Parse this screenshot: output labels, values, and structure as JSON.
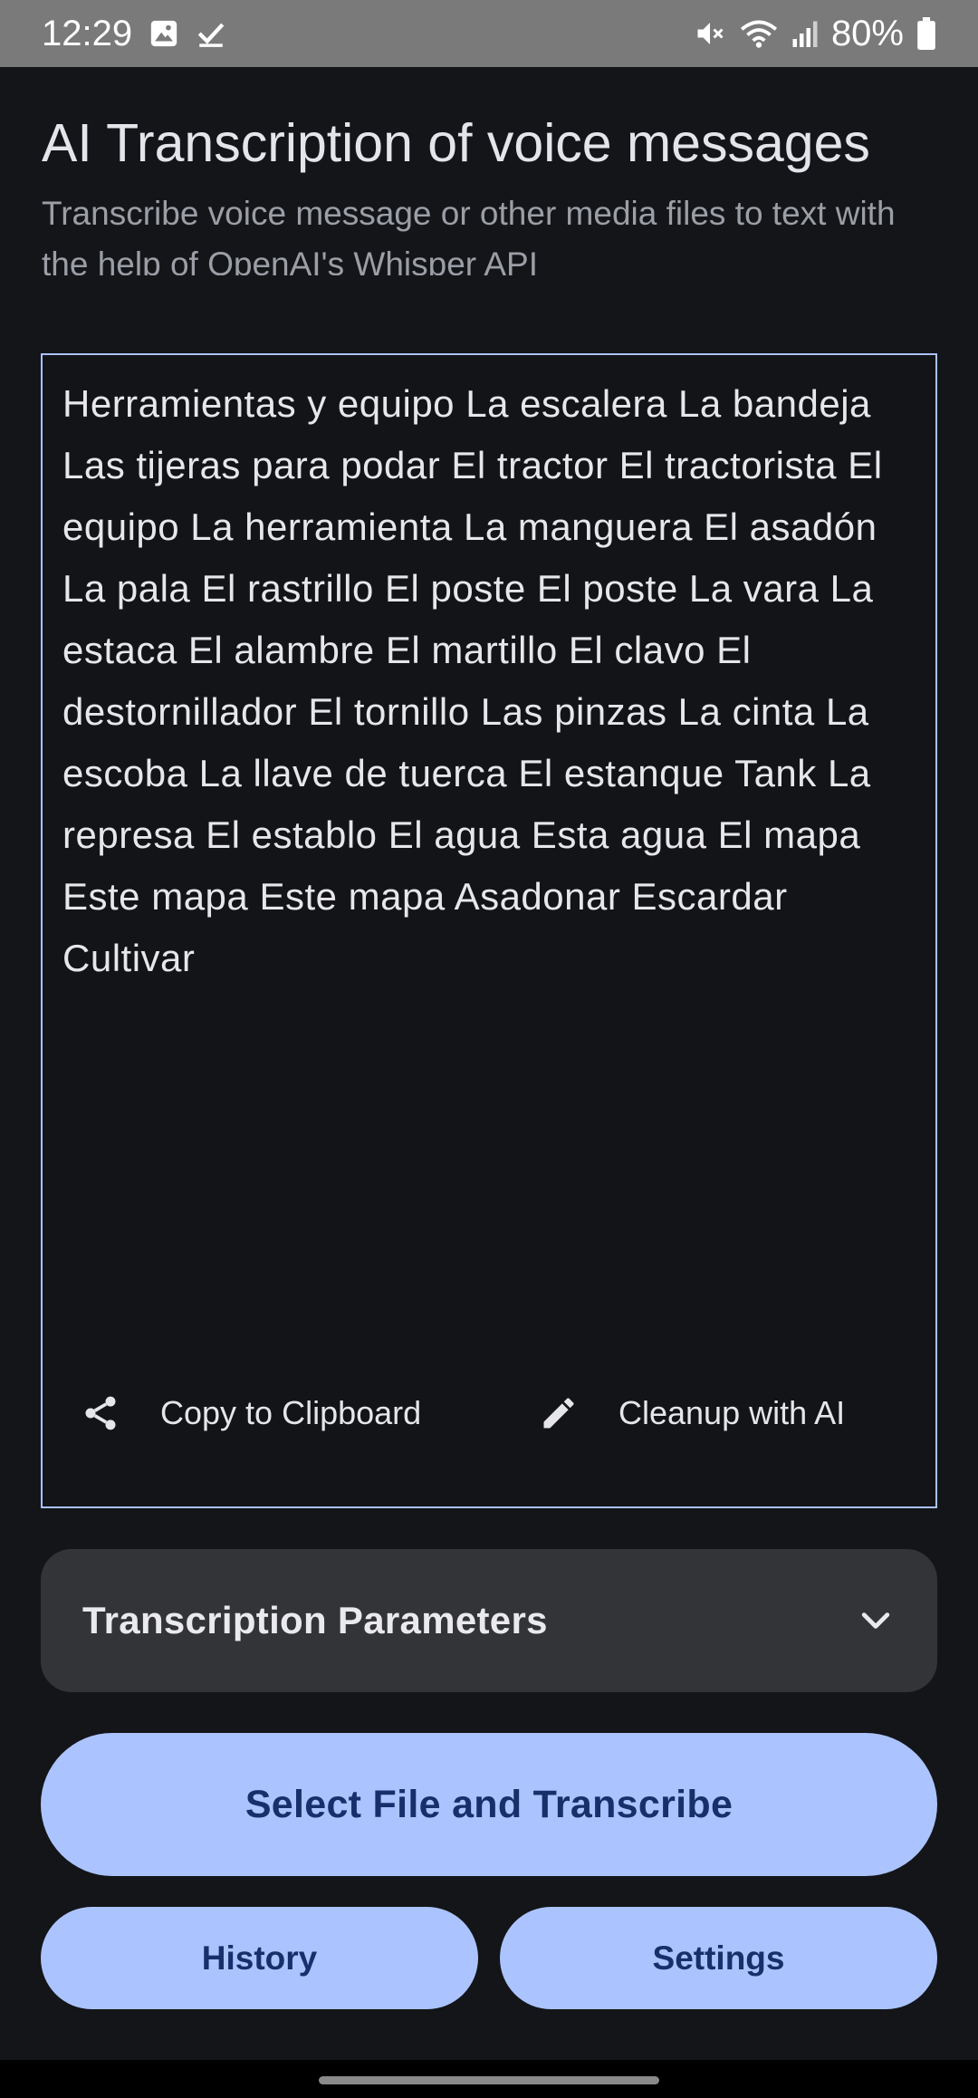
{
  "status_bar": {
    "time": "12:29",
    "battery_percent": "80%",
    "left_icons": [
      "gallery-icon",
      "check-icon"
    ],
    "right_icons": [
      "mute-icon",
      "wifi-icon",
      "signal-icon",
      "battery-icon"
    ]
  },
  "header": {
    "title": "AI Transcription of voice messages",
    "subtitle": "Transcribe voice message or other media files to text with the help of OpenAI's Whisper API"
  },
  "transcript": {
    "text": "Herramientas y equipo La escalera La bandeja Las tijeras para podar El tractor El tractorista El equipo La herramienta La manguera El asadón La pala El rastrillo El poste El poste La vara La estaca El alambre El martillo El clavo El destornillador El tornillo Las pinzas La cinta La escoba La llave de tuerca El estanque Tank La represa El establo El agua Esta agua El mapa Este mapa Este mapa Asadonar Escardar Cultivar",
    "copy_label": "Copy to Clipboard",
    "copy_icon": "share-icon",
    "cleanup_label": "Cleanup with AI",
    "cleanup_icon": "pencil-icon"
  },
  "params": {
    "label": "Transcription Parameters",
    "icon": "chevron-down-icon"
  },
  "buttons": {
    "primary": "Select File and Transcribe",
    "history": "History",
    "settings": "Settings"
  },
  "colors": {
    "background": "#141519",
    "accent": "#abc4ff",
    "accent_text": "#17306b",
    "panel": "#333438",
    "border": "#a9c2ff"
  }
}
